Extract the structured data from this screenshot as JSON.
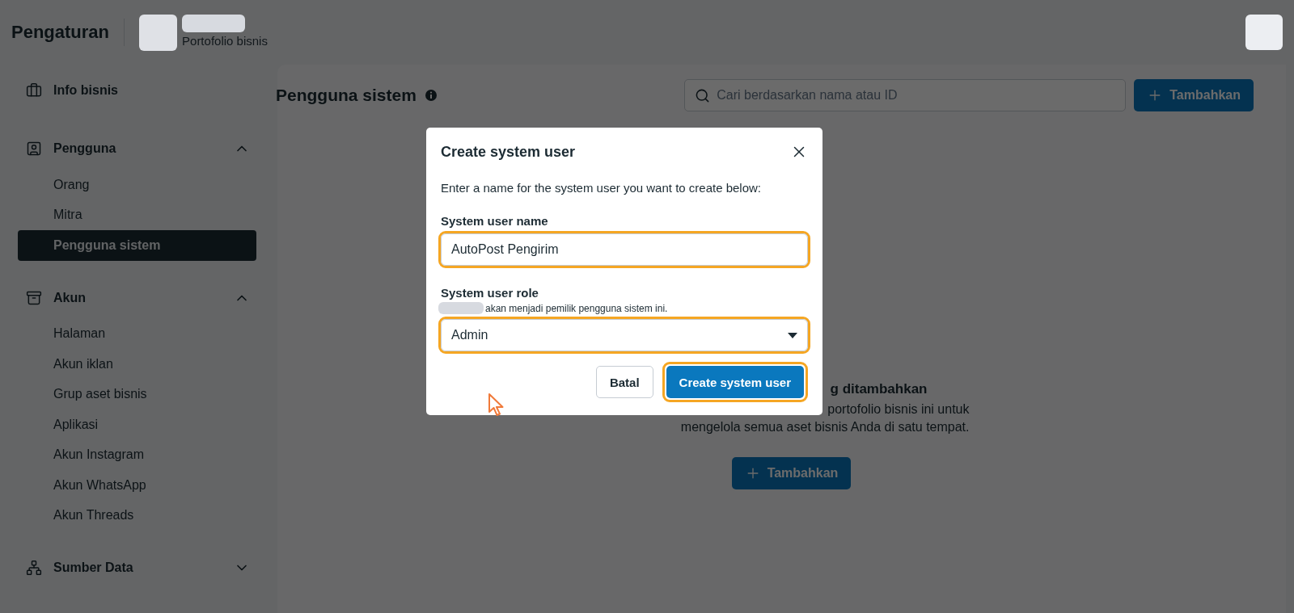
{
  "header": {
    "title": "Pengaturan",
    "business": {
      "subtitle": "Portofolio bisnis"
    }
  },
  "sidebar": {
    "sections": [
      {
        "label": "Info bisnis",
        "kind": "link"
      },
      {
        "label": "Pengguna",
        "kind": "group",
        "expanded": true,
        "children": [
          {
            "label": "Orang",
            "selected": false
          },
          {
            "label": "Mitra",
            "selected": false
          },
          {
            "label": "Pengguna sistem",
            "selected": true
          }
        ]
      },
      {
        "label": "Akun",
        "kind": "group",
        "expanded": true,
        "children": [
          {
            "label": "Halaman",
            "selected": false
          },
          {
            "label": "Akun iklan",
            "selected": false
          },
          {
            "label": "Grup aset bisnis",
            "selected": false
          },
          {
            "label": "Aplikasi",
            "selected": false
          },
          {
            "label": "Akun Instagram",
            "selected": false
          },
          {
            "label": "Akun WhatsApp",
            "selected": false
          },
          {
            "label": "Akun Threads",
            "selected": false
          }
        ]
      },
      {
        "label": "Sumber Data",
        "kind": "group",
        "expanded": false
      }
    ]
  },
  "page": {
    "title": "Pengguna sistem",
    "search": {
      "placeholder": "Cari berdasarkan nama atau ID"
    },
    "add_button": "Tambahkan",
    "empty_state": {
      "heading": "g ditambahkan",
      "lines": [
        "portofolio bisnis ini untuk",
        "mengelola semua aset bisnis Anda di satu tempat."
      ],
      "button": "Tambahkan"
    }
  },
  "dialog": {
    "title": "Create system user",
    "description": "Enter a name for the system user you want to create below:",
    "name_field": {
      "label": "System user name",
      "value": "AutoPost Pengirim",
      "highlighted": true
    },
    "role_field": {
      "label": "System user role",
      "owner_note": "akan menjadi pemilik pengguna sistem ini.",
      "value": "Admin",
      "highlighted": true
    },
    "buttons": [
      {
        "label": "Batal",
        "kind": "secondary",
        "highlighted": false
      },
      {
        "label": "Create system user",
        "kind": "primary",
        "highlighted": true
      }
    ]
  }
}
